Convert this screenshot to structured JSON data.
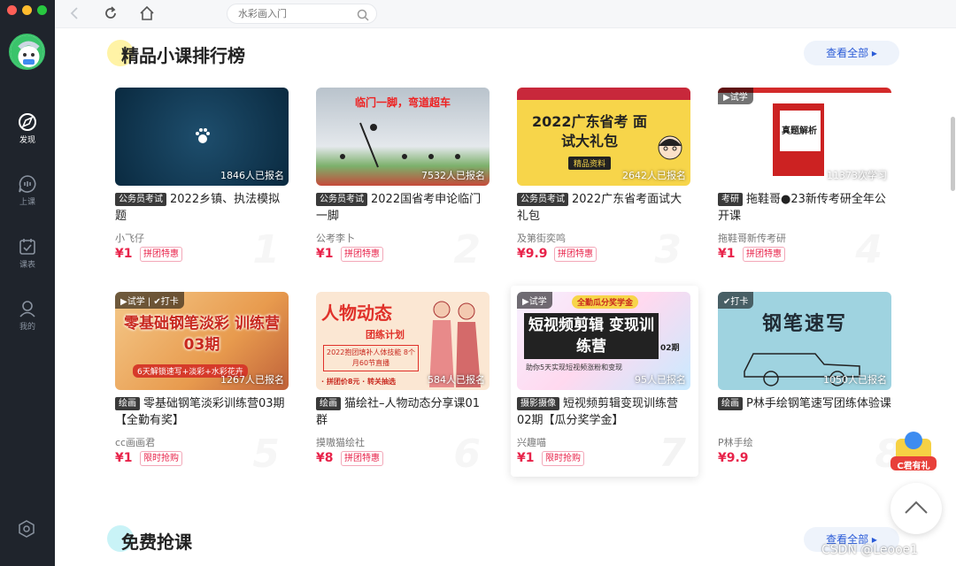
{
  "sidebar": {
    "items": [
      {
        "label": "发现",
        "icon": "compass-icon"
      },
      {
        "label": "上课",
        "icon": "live-class-icon"
      },
      {
        "label": "课表",
        "icon": "schedule-icon"
      },
      {
        "label": "我的",
        "icon": "profile-icon"
      }
    ],
    "settings_icon": "settings-icon"
  },
  "topbar": {
    "search_placeholder": "水彩画入门"
  },
  "sections": [
    {
      "title": "精品小课排行榜",
      "more": "查看全部 ▸"
    },
    {
      "title": "免费抢课",
      "more": "查看全部 ▸"
    }
  ],
  "cards": [
    {
      "thumb_text": "",
      "enroll": "1846人已报名",
      "tag": "公务员考试",
      "title": "2022乡镇、执法模拟题",
      "author": "小飞仔",
      "price": "¥1",
      "promo": "拼团特惠",
      "rank": "1"
    },
    {
      "thumb_text": "临门一脚，弯道超车",
      "enroll": "7532人已报名",
      "tag": "公务员考试",
      "title": "2022国省考申论临门一脚",
      "author": "公考李卜",
      "price": "¥1",
      "promo": "拼团特惠",
      "rank": "2"
    },
    {
      "thumb_text": "2022广东省考 面试大礼包",
      "thumb_sub": "精品资料",
      "enroll": "2642人已报名",
      "tag": "公务员考试",
      "title": "2022广东省考面试大礼包",
      "author": "及第街奕鸣",
      "price": "¥9.9",
      "promo": "拼团特惠",
      "rank": "3"
    },
    {
      "thumb_text": "真题解析",
      "trial": "▶试学",
      "enroll": "11373次学习",
      "tag": "考研",
      "title": "拖鞋哥●23新传考研全年公开课",
      "author": "拖鞋哥新传考研",
      "price": "¥1",
      "promo": "拼团特惠",
      "rank": "4"
    },
    {
      "thumb_text": "零基础钢笔淡彩 训练营03期",
      "thumb_sub": "6天解锁速写+淡彩+水彩花卉",
      "trial": "▶试学 | ✔打卡",
      "enroll": "1267人已报名",
      "tag": "绘画",
      "title": "零基础钢笔淡彩训练营03期【全勤有奖】",
      "author": "cc画画君",
      "price": "¥1",
      "promo": "限时抢购",
      "rank": "5"
    },
    {
      "thumb_text": "人物动态",
      "thumb_sub": "团练计划",
      "thumb_sub2": "2022抱团填补人体技能 8个月60节直播",
      "thumb_sub3": "· 拼团价8元 · 转关抽选",
      "enroll": "584人已报名",
      "tag": "绘画",
      "title": "猫绘社–人物动态分享课01群",
      "author": "摸嗷猫绘社",
      "price": "¥8",
      "promo": "拼团特惠",
      "rank": "6"
    },
    {
      "thumb_text": "短视频剪辑 变现训练营",
      "thumb_sub": "助你5天实现短视频涨粉和变现",
      "thumb_badge": "全勤瓜分奖学金",
      "thumb_period": "02期",
      "trial": "▶试学",
      "enroll": "95人已报名",
      "tag": "摄影摄像",
      "title": "短视频剪辑变现训练营02期【瓜分奖学金】",
      "author": "兴趣喵",
      "price": "¥1",
      "promo": "限时抢购",
      "rank": "7"
    },
    {
      "thumb_text": "钢笔速写",
      "trial": "✔打卡",
      "enroll": "1050人已报名",
      "tag": "绘画",
      "title": "P林手绘钢笔速写团练体验课",
      "author": "P林手绘",
      "price": "¥9.9",
      "promo": "",
      "rank": "8"
    }
  ],
  "gift_label": "C君有礼",
  "watermark": "CSDN @Leooe1"
}
